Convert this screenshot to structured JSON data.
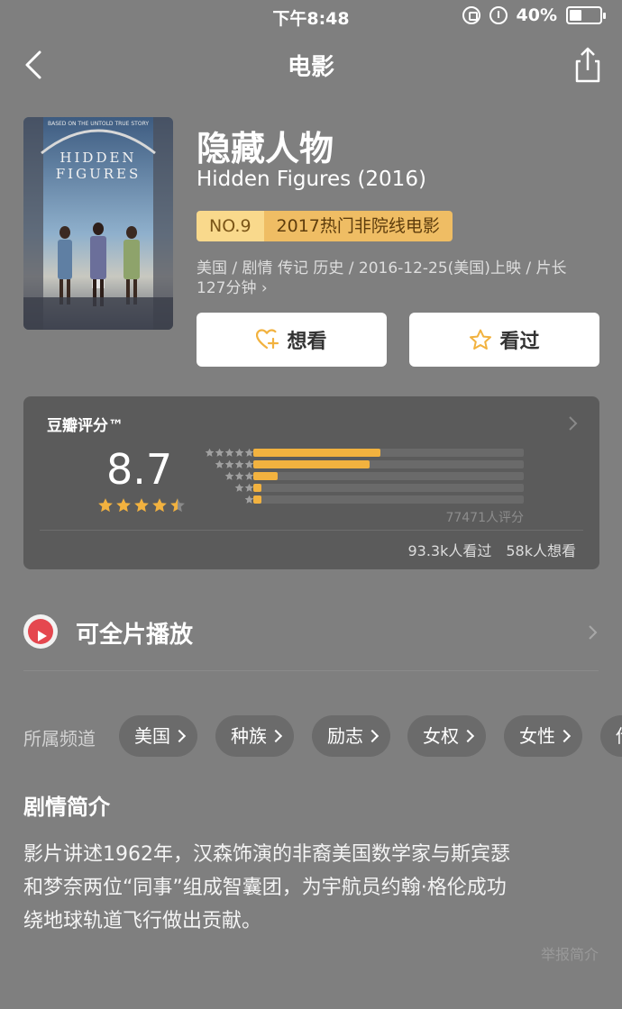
{
  "status": {
    "time": "下午8:48",
    "battery": "40%",
    "battery_level": 0.4
  },
  "nav": {
    "title": "电影",
    "back_icon": "chevron-left-icon",
    "share_icon": "share-icon"
  },
  "movie": {
    "title_cn": "隐藏人物",
    "title_en": "Hidden Figures (2016)",
    "rank_no": "NO.9",
    "rank_text": "2017热门非院线电影",
    "meta_line1": "美国 / 剧情 传记 历史 / 2016-12-25(美国)上映 / 片长",
    "meta_line2": "127分钟 ›",
    "poster": {
      "tagline": "BASED ON THE UNTOLD TRUE STORY",
      "title_line1": "HIDDEN",
      "title_line2": "FIGURES"
    }
  },
  "actions": {
    "want_label": "想看",
    "seen_label": "看过",
    "want_icon": "heart-plus-icon",
    "seen_icon": "star-outline-icon",
    "accent": "#f2b23f"
  },
  "rating": {
    "label": "豆瓣评分™",
    "score": "8.7",
    "stars_value": 4.5,
    "distribution": [
      {
        "stars": 5,
        "fraction": 0.47
      },
      {
        "stars": 4,
        "fraction": 0.43
      },
      {
        "stars": 3,
        "fraction": 0.09
      },
      {
        "stars": 2,
        "fraction": 0.03
      },
      {
        "stars": 1,
        "fraction": 0.03
      }
    ],
    "raters": "77471人评分",
    "seen_count": "93.3k人看过",
    "want_count": "58k人想看"
  },
  "play": {
    "label": "可全片播放",
    "icon": "play-icon"
  },
  "channels": {
    "label": "所属频道",
    "tags": [
      "美国",
      "种族",
      "励志",
      "女权",
      "女性",
      "传"
    ]
  },
  "synopsis": {
    "title": "剧情简介",
    "line1": "影片讲述1962年，汉森饰演的非裔美国数学家与斯宾瑟",
    "line2": "和梦奈两位“同事”组成智囊团，为宇航员约翰·格伦成功",
    "line3": "绕地球轨道飞行做出贡献。",
    "report_link": "举报简介"
  }
}
